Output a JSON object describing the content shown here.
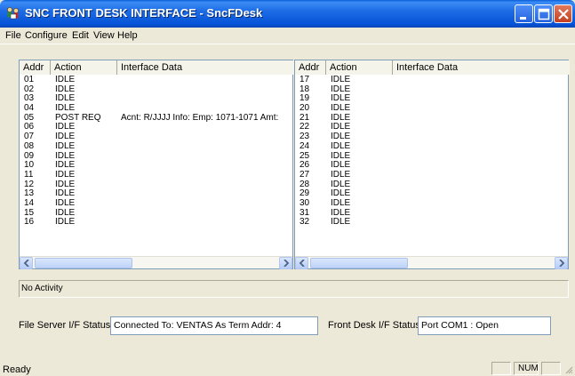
{
  "window": {
    "title": "SNC FRONT DESK INTERFACE - SncFDesk"
  },
  "menu": [
    "File",
    "Configure",
    "Edit",
    "View",
    "Help"
  ],
  "columns": [
    "Addr",
    "Action",
    "Interface Data"
  ],
  "left_rows": [
    {
      "addr": "01",
      "action": "IDLE",
      "data": ""
    },
    {
      "addr": "02",
      "action": "IDLE",
      "data": ""
    },
    {
      "addr": "03",
      "action": "IDLE",
      "data": ""
    },
    {
      "addr": "04",
      "action": "IDLE",
      "data": ""
    },
    {
      "addr": "05",
      "action": "POST REQ",
      "data": "Acnt: R/JJJJ Info: Emp: 1071-1071 Amt:"
    },
    {
      "addr": "06",
      "action": "IDLE",
      "data": ""
    },
    {
      "addr": "07",
      "action": "IDLE",
      "data": ""
    },
    {
      "addr": "08",
      "action": "IDLE",
      "data": ""
    },
    {
      "addr": "09",
      "action": "IDLE",
      "data": ""
    },
    {
      "addr": "10",
      "action": "IDLE",
      "data": ""
    },
    {
      "addr": "11",
      "action": "IDLE",
      "data": ""
    },
    {
      "addr": "12",
      "action": "IDLE",
      "data": ""
    },
    {
      "addr": "13",
      "action": "IDLE",
      "data": ""
    },
    {
      "addr": "14",
      "action": "IDLE",
      "data": ""
    },
    {
      "addr": "15",
      "action": "IDLE",
      "data": ""
    },
    {
      "addr": "16",
      "action": "IDLE",
      "data": ""
    }
  ],
  "right_rows": [
    {
      "addr": "17",
      "action": "IDLE",
      "data": ""
    },
    {
      "addr": "18",
      "action": "IDLE",
      "data": ""
    },
    {
      "addr": "19",
      "action": "IDLE",
      "data": ""
    },
    {
      "addr": "20",
      "action": "IDLE",
      "data": ""
    },
    {
      "addr": "21",
      "action": "IDLE",
      "data": ""
    },
    {
      "addr": "22",
      "action": "IDLE",
      "data": ""
    },
    {
      "addr": "23",
      "action": "IDLE",
      "data": ""
    },
    {
      "addr": "24",
      "action": "IDLE",
      "data": ""
    },
    {
      "addr": "25",
      "action": "IDLE",
      "data": ""
    },
    {
      "addr": "26",
      "action": "IDLE",
      "data": ""
    },
    {
      "addr": "27",
      "action": "IDLE",
      "data": ""
    },
    {
      "addr": "28",
      "action": "IDLE",
      "data": ""
    },
    {
      "addr": "29",
      "action": "IDLE",
      "data": ""
    },
    {
      "addr": "30",
      "action": "IDLE",
      "data": ""
    },
    {
      "addr": "31",
      "action": "IDLE",
      "data": ""
    },
    {
      "addr": "32",
      "action": "IDLE",
      "data": ""
    }
  ],
  "activity": "No Activity",
  "file_server": {
    "label": "File Server I/F Status:",
    "value": "Connected To: VENTAS As Term Addr: 4"
  },
  "front_desk": {
    "label": "Front Desk I/F Status:",
    "value": "Port COM1 : Open"
  },
  "statusbar": {
    "ready": "Ready",
    "num": "NUM"
  },
  "icons": {
    "app": "people-group-icon",
    "minimize": "minimize-icon",
    "maximize": "maximize-icon",
    "close": "close-icon",
    "scroll_left": "arrow-left-icon",
    "scroll_right": "arrow-right-icon",
    "grip": "resize-grip-icon"
  },
  "colors": {
    "titlebar": "#0553d6",
    "close_button": "#c4401f",
    "window_bg": "#ece9d8",
    "list_border": "#7f9db9"
  }
}
